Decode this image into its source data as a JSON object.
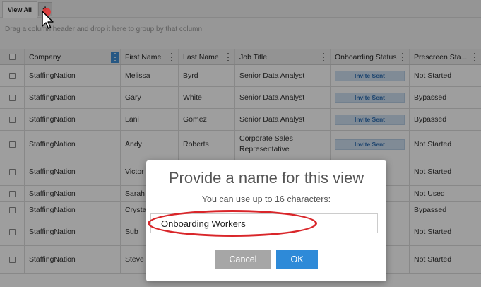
{
  "tabs": {
    "view_all": "View All",
    "add": "+"
  },
  "group_hint": "Drag a column header and drop it here to group by that column",
  "columns": [
    "Company",
    "First Name",
    "Last Name",
    "Job Title",
    "Onboarding Status",
    "Prescreen Sta..."
  ],
  "rows": [
    {
      "company": "StaffingNation",
      "first": "Melissa",
      "last": "Byrd",
      "title": "Senior Data Analyst",
      "onboarding": "Invite Sent",
      "prescreen": "Not Started"
    },
    {
      "company": "StaffingNation",
      "first": "Gary",
      "last": "White",
      "title": "Senior Data Analyst",
      "onboarding": "Invite Sent",
      "prescreen": "Bypassed"
    },
    {
      "company": "StaffingNation",
      "first": "Lani",
      "last": "Gomez",
      "title": "Senior Data Analyst",
      "onboarding": "Invite Sent",
      "prescreen": "Bypassed"
    },
    {
      "company": "StaffingNation",
      "first": "Andy",
      "last": "Roberts",
      "title": "Corporate Sales Representative",
      "onboarding": "Invite Sent",
      "prescreen": "Not Started"
    },
    {
      "company": "StaffingNation",
      "first": "Victor",
      "last": "",
      "title": "",
      "onboarding": "",
      "prescreen": "Not Started"
    },
    {
      "company": "StaffingNation",
      "first": "Sarah",
      "last": "",
      "title": "",
      "onboarding": "",
      "prescreen": "Not Used"
    },
    {
      "company": "StaffingNation",
      "first": "Crystal",
      "last": "",
      "title": "",
      "onboarding": "",
      "prescreen": "Bypassed"
    },
    {
      "company": "StaffingNation",
      "first": "Sub",
      "last": "",
      "title": "",
      "onboarding": "",
      "prescreen": "Not Started"
    },
    {
      "company": "StaffingNation",
      "first": "Steve",
      "last": "",
      "title": "",
      "onboarding": "",
      "prescreen": "Not Started"
    }
  ],
  "dialog": {
    "title": "Provide a name for this view",
    "subtitle": "You can use up to 16 characters:",
    "input_value": "Onboarding Workers",
    "cancel_label": "Cancel",
    "ok_label": "OK"
  },
  "colors": {
    "accent": "#2e8ad8",
    "highlight": "#d9262a",
    "badge_bg": "#cfe1f2"
  }
}
